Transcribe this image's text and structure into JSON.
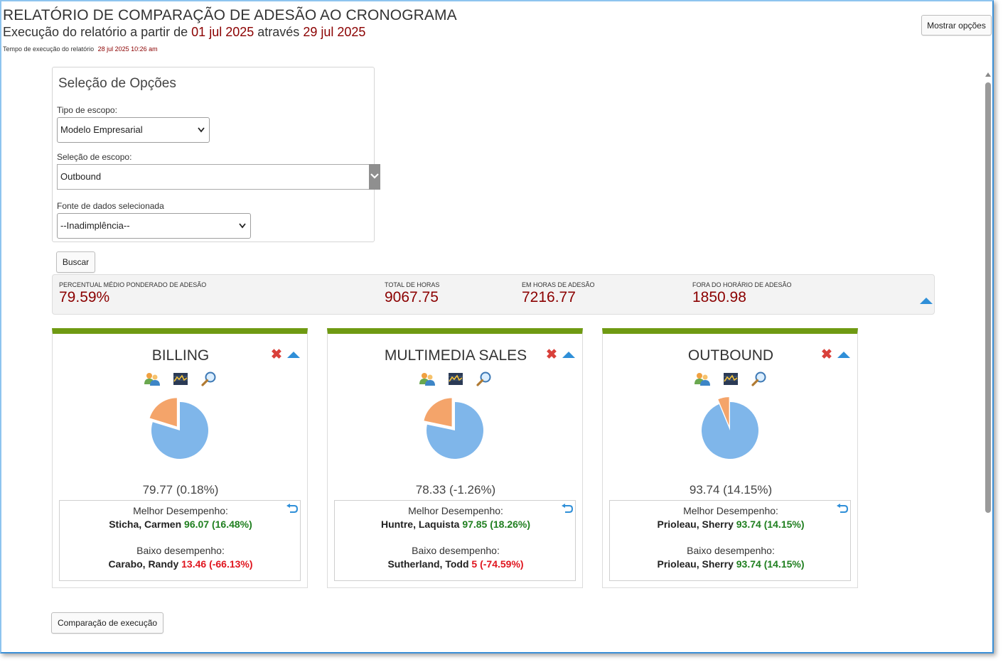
{
  "header": {
    "title": "RELATÓRIO DE COMPARAÇÃO DE ADESÃO AO CRONOGRAMA",
    "subtitle_prefix": "Execução do relatório a partir de",
    "start_date": "01 jul 2025",
    "subtitle_mid": "através",
    "end_date": "29 jul 2025",
    "exec_label": "Tempo de execução do relatório",
    "exec_time": "28 jul 2025 10:26 am",
    "show_options_label": "Mostrar opções"
  },
  "options": {
    "title": "Seleção de Opções",
    "scope_type_label": "Tipo de escopo:",
    "scope_type_value": "Modelo Empresarial",
    "scope_selection_label": "Seleção de escopo:",
    "scope_selection_value": "Outbound",
    "data_source_label": "Fonte de dados selecionada",
    "data_source_value": "--Inadimplência--",
    "search_label": "Buscar"
  },
  "summary": {
    "metrics": [
      {
        "label": "PERCENTUAL MÉDIO PONDERADO DE ADESÃO",
        "value": "79.59%"
      },
      {
        "label": "TOTAL DE HORAS",
        "value": "9067.75"
      },
      {
        "label": "EM HORAS DE ADESÃO",
        "value": "7216.77"
      },
      {
        "label": "FORA DO HORÁRIO DE ADESÃO",
        "value": "1850.98"
      }
    ]
  },
  "cards": [
    {
      "title": "BILLING",
      "score": "79.77 (0.18%)",
      "adherence_fraction": 0.7977,
      "best_label": "Melhor Desempenho:",
      "best_name": "Sticha, Carmen",
      "best_value": "96.07 (16.48%)",
      "worst_label": "Baixo desempenho:",
      "worst_name": "Carabo, Randy",
      "worst_value": "13.46 (-66.13%)",
      "worst_positive": false
    },
    {
      "title": "MULTIMEDIA SALES",
      "score": "78.33 (-1.26%)",
      "adherence_fraction": 0.7833,
      "best_label": "Melhor Desempenho:",
      "best_name": "Huntre, Laquista",
      "best_value": "97.85 (18.26%)",
      "worst_label": "Baixo desempenho:",
      "worst_name": "Sutherland, Todd",
      "worst_value": "5 (-74.59%)",
      "worst_positive": false
    },
    {
      "title": "OUTBOUND",
      "score": "93.74 (14.15%)",
      "adherence_fraction": 0.9374,
      "best_label": "Melhor Desempenho:",
      "best_name": "Prioleau, Sherry",
      "best_value": "93.74 (14.15%)",
      "worst_label": "Baixo desempenho:",
      "worst_name": "Prioleau, Sherry",
      "worst_value": "93.74 (14.15%)",
      "worst_positive": true
    }
  ],
  "footer": {
    "compare_label": "Comparação de execução"
  },
  "colors": {
    "accent_green": "#6f9a12",
    "date_red": "#8b0000",
    "pie_in": "#7fb6ea",
    "pie_out": "#f4a46a",
    "good": "#1f7f1f",
    "bad": "#e0161f",
    "close_red": "#d9403a",
    "arrow_blue": "#2f8fd8"
  },
  "icons": [
    "team-icon",
    "chart-icon",
    "magnifier-icon",
    "close-icon",
    "collapse-icon",
    "reset-icon"
  ]
}
